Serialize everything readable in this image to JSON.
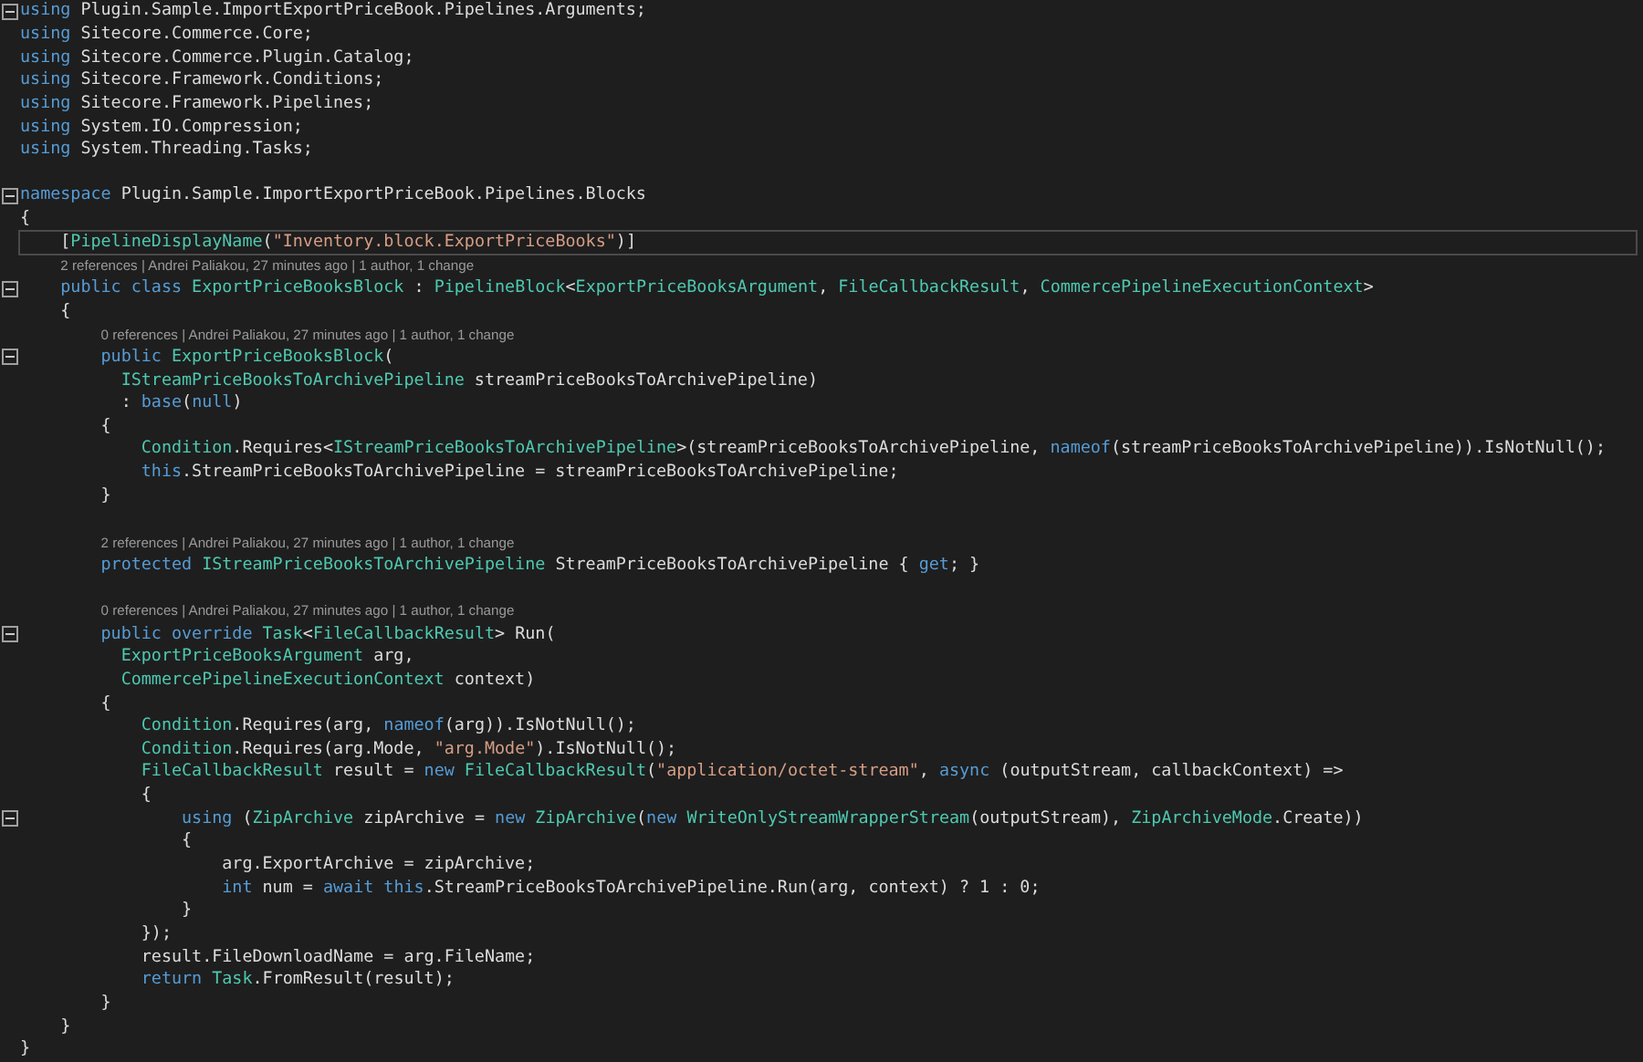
{
  "editor": {
    "lines": [
      {
        "kind": "code",
        "collapsible": true,
        "current": false,
        "tokens": [
          {
            "kind": "kw",
            "text": "using"
          },
          {
            "kind": "plain",
            "text": " Plugin.Sample.ImportExportPriceBook.Pipelines.Arguments;"
          }
        ]
      },
      {
        "kind": "code",
        "collapsible": false,
        "current": false,
        "tokens": [
          {
            "kind": "kw",
            "text": "using"
          },
          {
            "kind": "plain",
            "text": " Sitecore.Commerce.Core;"
          }
        ]
      },
      {
        "kind": "code",
        "collapsible": false,
        "current": false,
        "tokens": [
          {
            "kind": "kw",
            "text": "using"
          },
          {
            "kind": "plain",
            "text": " Sitecore.Commerce.Plugin.Catalog;"
          }
        ]
      },
      {
        "kind": "code",
        "collapsible": false,
        "current": false,
        "tokens": [
          {
            "kind": "kw",
            "text": "using"
          },
          {
            "kind": "plain",
            "text": " Sitecore.Framework.Conditions;"
          }
        ]
      },
      {
        "kind": "code",
        "collapsible": false,
        "current": false,
        "tokens": [
          {
            "kind": "kw",
            "text": "using"
          },
          {
            "kind": "plain",
            "text": " Sitecore.Framework.Pipelines;"
          }
        ]
      },
      {
        "kind": "code",
        "collapsible": false,
        "current": false,
        "tokens": [
          {
            "kind": "kw",
            "text": "using"
          },
          {
            "kind": "plain",
            "text": " System.IO.Compression;"
          }
        ]
      },
      {
        "kind": "code",
        "collapsible": false,
        "current": false,
        "tokens": [
          {
            "kind": "kw",
            "text": "using"
          },
          {
            "kind": "plain",
            "text": " System.Threading.Tasks;"
          }
        ]
      },
      {
        "kind": "blank"
      },
      {
        "kind": "code",
        "collapsible": true,
        "current": false,
        "tokens": [
          {
            "kind": "kw",
            "text": "namespace"
          },
          {
            "kind": "plain",
            "text": " Plugin.Sample.ImportExportPriceBook.Pipelines.Blocks"
          }
        ]
      },
      {
        "kind": "code",
        "collapsible": false,
        "current": false,
        "tokens": [
          {
            "kind": "plain",
            "text": "{"
          }
        ]
      },
      {
        "kind": "code",
        "collapsible": false,
        "current": true,
        "tokens": [
          {
            "kind": "plain",
            "text": "    ["
          },
          {
            "kind": "type",
            "text": "PipelineDisplayName"
          },
          {
            "kind": "plain",
            "text": "("
          },
          {
            "kind": "str",
            "text": "\"Inventory.block.ExportPriceBooks\""
          },
          {
            "kind": "plain",
            "text": ")]"
          }
        ]
      },
      {
        "kind": "lens",
        "text": "2 references | Andrei Paliakou, 27 minutes ago | 1 author, 1 change"
      },
      {
        "kind": "code",
        "collapsible": true,
        "current": false,
        "tokens": [
          {
            "kind": "kw",
            "text": "    public class "
          },
          {
            "kind": "type",
            "text": "ExportPriceBooksBlock"
          },
          {
            "kind": "plain",
            "text": " : "
          },
          {
            "kind": "type",
            "text": "PipelineBlock"
          },
          {
            "kind": "plain",
            "text": "<"
          },
          {
            "kind": "type",
            "text": "ExportPriceBooksArgument"
          },
          {
            "kind": "plain",
            "text": ", "
          },
          {
            "kind": "type",
            "text": "FileCallbackResult"
          },
          {
            "kind": "plain",
            "text": ", "
          },
          {
            "kind": "type",
            "text": "CommercePipelineExecutionContext"
          },
          {
            "kind": "plain",
            "text": ">"
          }
        ]
      },
      {
        "kind": "code",
        "collapsible": false,
        "current": false,
        "tokens": [
          {
            "kind": "plain",
            "text": "    {"
          }
        ]
      },
      {
        "kind": "lens",
        "text": "0 references | Andrei Paliakou, 27 minutes ago | 1 author, 1 change"
      },
      {
        "kind": "code",
        "collapsible": true,
        "current": false,
        "tokens": [
          {
            "kind": "kw",
            "text": "        public "
          },
          {
            "kind": "type",
            "text": "ExportPriceBooksBlock"
          },
          {
            "kind": "plain",
            "text": "("
          }
        ]
      },
      {
        "kind": "code",
        "collapsible": false,
        "current": false,
        "tokens": [
          {
            "kind": "type",
            "text": "          IStreamPriceBooksToArchivePipeline"
          },
          {
            "kind": "plain",
            "text": " streamPriceBooksToArchivePipeline)"
          }
        ]
      },
      {
        "kind": "code",
        "collapsible": false,
        "current": false,
        "tokens": [
          {
            "kind": "plain",
            "text": "          : "
          },
          {
            "kind": "kw",
            "text": "base"
          },
          {
            "kind": "plain",
            "text": "("
          },
          {
            "kind": "kw",
            "text": "null"
          },
          {
            "kind": "plain",
            "text": ")"
          }
        ]
      },
      {
        "kind": "code",
        "collapsible": false,
        "current": false,
        "tokens": [
          {
            "kind": "plain",
            "text": "        {"
          }
        ]
      },
      {
        "kind": "code",
        "collapsible": false,
        "current": false,
        "tokens": [
          {
            "kind": "type",
            "text": "            Condition"
          },
          {
            "kind": "plain",
            "text": ".Requires<"
          },
          {
            "kind": "type",
            "text": "IStreamPriceBooksToArchivePipeline"
          },
          {
            "kind": "plain",
            "text": ">(streamPriceBooksToArchivePipeline, "
          },
          {
            "kind": "kw",
            "text": "nameof"
          },
          {
            "kind": "plain",
            "text": "(streamPriceBooksToArchivePipeline)).IsNotNull();"
          }
        ]
      },
      {
        "kind": "code",
        "collapsible": false,
        "current": false,
        "tokens": [
          {
            "kind": "kw",
            "text": "            this"
          },
          {
            "kind": "plain",
            "text": ".StreamPriceBooksToArchivePipeline = streamPriceBooksToArchivePipeline;"
          }
        ]
      },
      {
        "kind": "code",
        "collapsible": false,
        "current": false,
        "tokens": [
          {
            "kind": "plain",
            "text": "        }"
          }
        ]
      },
      {
        "kind": "blank"
      },
      {
        "kind": "lens",
        "text": "2 references | Andrei Paliakou, 27 minutes ago | 1 author, 1 change"
      },
      {
        "kind": "code",
        "collapsible": false,
        "current": false,
        "tokens": [
          {
            "kind": "kw",
            "text": "        protected "
          },
          {
            "kind": "type",
            "text": "IStreamPriceBooksToArchivePipeline"
          },
          {
            "kind": "plain",
            "text": " StreamPriceBooksToArchivePipeline { "
          },
          {
            "kind": "kw",
            "text": "get"
          },
          {
            "kind": "plain",
            "text": "; }"
          }
        ]
      },
      {
        "kind": "blank"
      },
      {
        "kind": "lens",
        "text": "0 references | Andrei Paliakou, 27 minutes ago | 1 author, 1 change"
      },
      {
        "kind": "code",
        "collapsible": true,
        "current": false,
        "tokens": [
          {
            "kind": "kw",
            "text": "        public override "
          },
          {
            "kind": "type",
            "text": "Task"
          },
          {
            "kind": "plain",
            "text": "<"
          },
          {
            "kind": "type",
            "text": "FileCallbackResult"
          },
          {
            "kind": "plain",
            "text": "> Run("
          }
        ]
      },
      {
        "kind": "code",
        "collapsible": false,
        "current": false,
        "tokens": [
          {
            "kind": "type",
            "text": "          ExportPriceBooksArgument"
          },
          {
            "kind": "plain",
            "text": " arg,"
          }
        ]
      },
      {
        "kind": "code",
        "collapsible": false,
        "current": false,
        "tokens": [
          {
            "kind": "type",
            "text": "          CommercePipelineExecutionContext"
          },
          {
            "kind": "plain",
            "text": " context)"
          }
        ]
      },
      {
        "kind": "code",
        "collapsible": false,
        "current": false,
        "tokens": [
          {
            "kind": "plain",
            "text": "        {"
          }
        ]
      },
      {
        "kind": "code",
        "collapsible": false,
        "current": false,
        "tokens": [
          {
            "kind": "type",
            "text": "            Condition"
          },
          {
            "kind": "plain",
            "text": ".Requires(arg, "
          },
          {
            "kind": "kw",
            "text": "nameof"
          },
          {
            "kind": "plain",
            "text": "(arg)).IsNotNull();"
          }
        ]
      },
      {
        "kind": "code",
        "collapsible": false,
        "current": false,
        "tokens": [
          {
            "kind": "type",
            "text": "            Condition"
          },
          {
            "kind": "plain",
            "text": ".Requires(arg.Mode, "
          },
          {
            "kind": "str",
            "text": "\"arg.Mode\""
          },
          {
            "kind": "plain",
            "text": ").IsNotNull();"
          }
        ]
      },
      {
        "kind": "code",
        "collapsible": false,
        "current": false,
        "tokens": [
          {
            "kind": "type",
            "text": "            FileCallbackResult"
          },
          {
            "kind": "plain",
            "text": " result = "
          },
          {
            "kind": "kw",
            "text": "new "
          },
          {
            "kind": "type",
            "text": "FileCallbackResult"
          },
          {
            "kind": "plain",
            "text": "("
          },
          {
            "kind": "str",
            "text": "\"application/octet-stream\""
          },
          {
            "kind": "plain",
            "text": ", "
          },
          {
            "kind": "kw",
            "text": "async"
          },
          {
            "kind": "plain",
            "text": " (outputStream, callbackContext) =>"
          }
        ]
      },
      {
        "kind": "code",
        "collapsible": false,
        "current": false,
        "tokens": [
          {
            "kind": "plain",
            "text": "            {"
          }
        ]
      },
      {
        "kind": "code",
        "collapsible": true,
        "current": false,
        "tokens": [
          {
            "kind": "kw",
            "text": "                using"
          },
          {
            "kind": "plain",
            "text": " ("
          },
          {
            "kind": "type",
            "text": "ZipArchive"
          },
          {
            "kind": "plain",
            "text": " zipArchive = "
          },
          {
            "kind": "kw",
            "text": "new "
          },
          {
            "kind": "type",
            "text": "ZipArchive"
          },
          {
            "kind": "plain",
            "text": "("
          },
          {
            "kind": "kw",
            "text": "new "
          },
          {
            "kind": "type",
            "text": "WriteOnlyStreamWrapperStream"
          },
          {
            "kind": "plain",
            "text": "(outputStream), "
          },
          {
            "kind": "type",
            "text": "ZipArchiveMode"
          },
          {
            "kind": "plain",
            "text": ".Create))"
          }
        ]
      },
      {
        "kind": "code",
        "collapsible": false,
        "current": false,
        "tokens": [
          {
            "kind": "plain",
            "text": "                {"
          }
        ]
      },
      {
        "kind": "code",
        "collapsible": false,
        "current": false,
        "tokens": [
          {
            "kind": "plain",
            "text": "                    arg.ExportArchive = zipArchive;"
          }
        ]
      },
      {
        "kind": "code",
        "collapsible": false,
        "current": false,
        "tokens": [
          {
            "kind": "kw",
            "text": "                    int"
          },
          {
            "kind": "plain",
            "text": " num = "
          },
          {
            "kind": "kw",
            "text": "await "
          },
          {
            "kind": "kw",
            "text": "this"
          },
          {
            "kind": "plain",
            "text": ".StreamPriceBooksToArchivePipeline.Run(arg, context) ? 1 : 0;"
          }
        ]
      },
      {
        "kind": "code",
        "collapsible": false,
        "current": false,
        "tokens": [
          {
            "kind": "plain",
            "text": "                }"
          }
        ]
      },
      {
        "kind": "code",
        "collapsible": false,
        "current": false,
        "tokens": [
          {
            "kind": "plain",
            "text": "            });"
          }
        ]
      },
      {
        "kind": "code",
        "collapsible": false,
        "current": false,
        "tokens": [
          {
            "kind": "plain",
            "text": "            result.FileDownloadName = arg.FileName;"
          }
        ]
      },
      {
        "kind": "code",
        "collapsible": false,
        "current": false,
        "tokens": [
          {
            "kind": "kw",
            "text": "            return "
          },
          {
            "kind": "type",
            "text": "Task"
          },
          {
            "kind": "plain",
            "text": ".FromResult(result);"
          }
        ]
      },
      {
        "kind": "code",
        "collapsible": false,
        "current": false,
        "tokens": [
          {
            "kind": "plain",
            "text": "        }"
          }
        ]
      },
      {
        "kind": "code",
        "collapsible": false,
        "current": false,
        "tokens": [
          {
            "kind": "plain",
            "text": "    }"
          }
        ]
      },
      {
        "kind": "code",
        "collapsible": false,
        "current": false,
        "tokens": [
          {
            "kind": "plain",
            "text": "}"
          }
        ]
      }
    ]
  }
}
